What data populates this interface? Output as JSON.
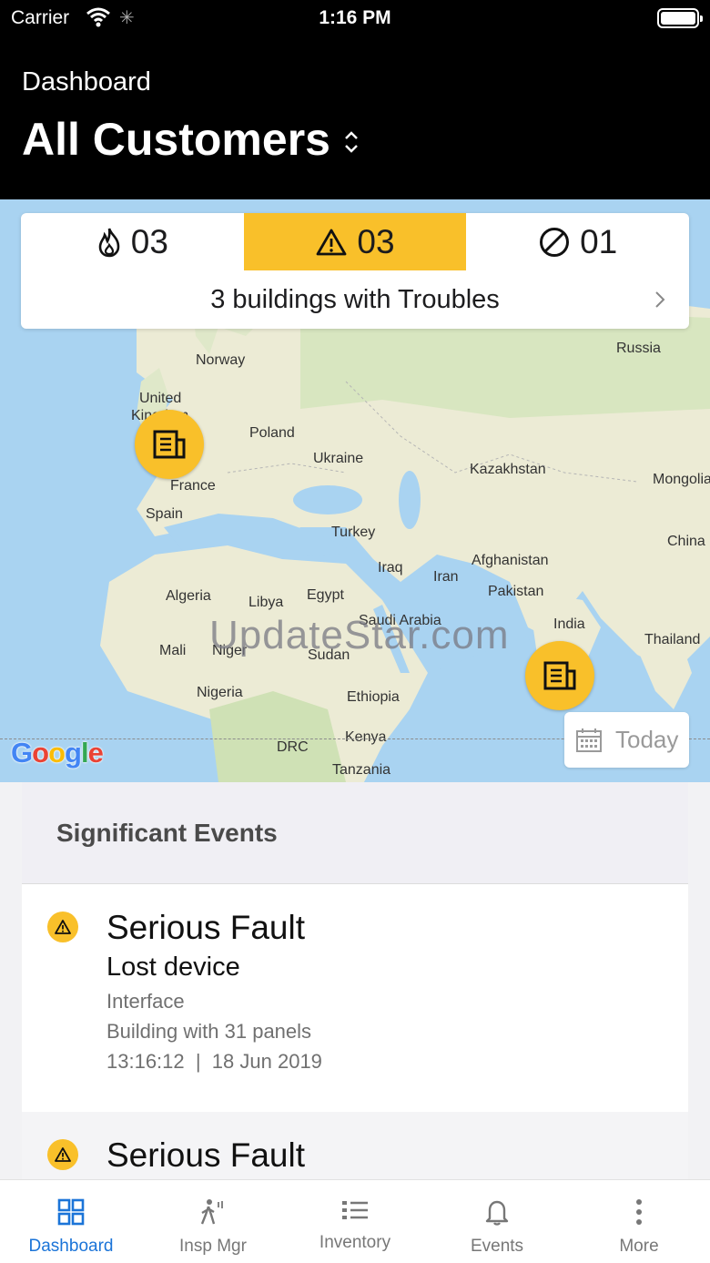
{
  "status_bar": {
    "carrier": "Carrier",
    "time": "1:16 PM"
  },
  "header": {
    "subtitle": "Dashboard",
    "title": "All Customers"
  },
  "summary": {
    "fire_count": "03",
    "trouble_count": "03",
    "disabled_count": "01",
    "message": "3 buildings with Troubles",
    "accent_color": "#f9c02a"
  },
  "map": {
    "countries": [
      {
        "name": "Norway"
      },
      {
        "name": "United"
      },
      {
        "name": "Kingdom"
      },
      {
        "name": "Poland"
      },
      {
        "name": "Ukraine"
      },
      {
        "name": "France"
      },
      {
        "name": "Spain"
      },
      {
        "name": "Russia"
      },
      {
        "name": "Kazakhstan"
      },
      {
        "name": "Mongolia"
      },
      {
        "name": "China"
      },
      {
        "name": "Turkey"
      },
      {
        "name": "Iraq"
      },
      {
        "name": "Iran"
      },
      {
        "name": "Afghanistan"
      },
      {
        "name": "Pakistan"
      },
      {
        "name": "India"
      },
      {
        "name": "Thailand"
      },
      {
        "name": "Algeria"
      },
      {
        "name": "Libya"
      },
      {
        "name": "Egypt"
      },
      {
        "name": "Saudi Arabia"
      },
      {
        "name": "Mali"
      },
      {
        "name": "Niger"
      },
      {
        "name": "Sudan"
      },
      {
        "name": "Nigeria"
      },
      {
        "name": "Ethiopia"
      },
      {
        "name": "Kenya"
      },
      {
        "name": "DRC"
      },
      {
        "name": "Tanzania"
      }
    ],
    "watermark": "UpdateStar.com",
    "provider_logo": "Google",
    "date_button": "Today"
  },
  "events": {
    "header": "Significant Events",
    "items": [
      {
        "type": "Serious Fault",
        "description": "Lost device",
        "source": "Interface",
        "building": "Building with 31 panels",
        "timestamp": "13:16:12  |  18 Jun 2019"
      },
      {
        "type": "Serious Fault"
      }
    ]
  },
  "tabs": [
    {
      "label": "Dashboard",
      "icon": "grid-icon",
      "active": true
    },
    {
      "label": "Insp Mgr",
      "icon": "walker-icon"
    },
    {
      "label": "Inventory",
      "icon": "list-icon"
    },
    {
      "label": "Events",
      "icon": "bell-icon"
    },
    {
      "label": "More",
      "icon": "more-icon"
    }
  ]
}
